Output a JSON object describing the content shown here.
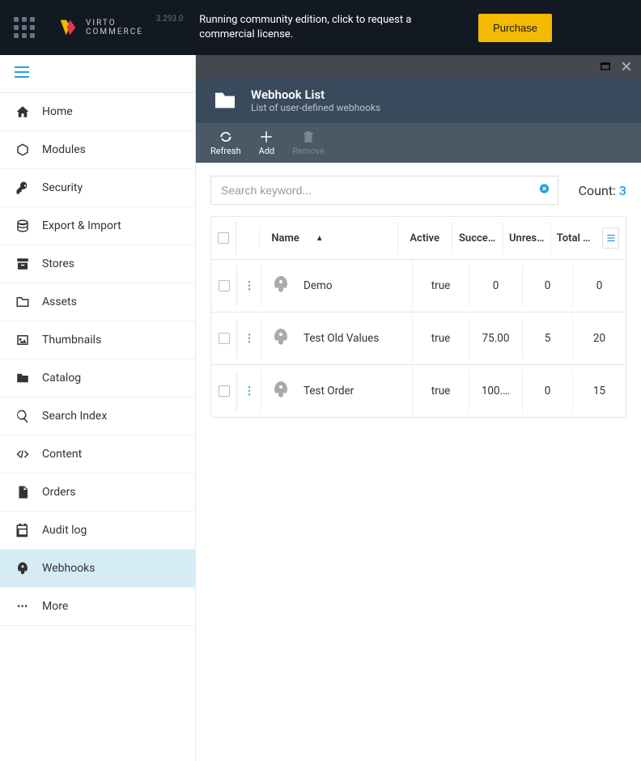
{
  "brand": {
    "line1": "VIRTO",
    "line2": "COMMERCE",
    "version": "3.293.0"
  },
  "banner": {
    "text": "Running community edition, click to request a commercial license.",
    "button": "Purchase"
  },
  "sidebar": {
    "items": [
      {
        "label": "Home",
        "icon": "home",
        "active": false
      },
      {
        "label": "Modules",
        "icon": "modules",
        "active": false
      },
      {
        "label": "Security",
        "icon": "key",
        "active": false
      },
      {
        "label": "Export & Import",
        "icon": "database",
        "active": false
      },
      {
        "label": "Stores",
        "icon": "archive",
        "active": false
      },
      {
        "label": "Assets",
        "icon": "folder",
        "active": false
      },
      {
        "label": "Thumbnails",
        "icon": "image",
        "active": false
      },
      {
        "label": "Catalog",
        "icon": "folder-solid",
        "active": false
      },
      {
        "label": "Search Index",
        "icon": "search",
        "active": false
      },
      {
        "label": "Content",
        "icon": "code",
        "active": false
      },
      {
        "label": "Orders",
        "icon": "file",
        "active": false
      },
      {
        "label": "Audit log",
        "icon": "calendar",
        "active": false
      },
      {
        "label": "Webhooks",
        "icon": "rocket",
        "active": true
      },
      {
        "label": "More",
        "icon": "more",
        "active": false
      }
    ]
  },
  "blade": {
    "title": "Webhook List",
    "subtitle": "List of user-defined webhooks",
    "toolbar": {
      "refresh": "Refresh",
      "add": "Add",
      "remove": "Remove"
    }
  },
  "search": {
    "placeholder": "Search keyword..."
  },
  "count": {
    "label": "Count: ",
    "value": "3"
  },
  "table": {
    "columns": {
      "name": "Name",
      "active": "Active",
      "success": "Succe…",
      "unres": "Unres…",
      "total": "Total …"
    },
    "rows": [
      {
        "name": "Demo",
        "active": "true",
        "success": "0",
        "unres": "0",
        "total": "0"
      },
      {
        "name": "Test Old Values",
        "active": "true",
        "success": "75.00",
        "unres": "5",
        "total": "20"
      },
      {
        "name": "Test Order",
        "active": "true",
        "success": "100.…",
        "unres": "0",
        "total": "15"
      }
    ]
  }
}
